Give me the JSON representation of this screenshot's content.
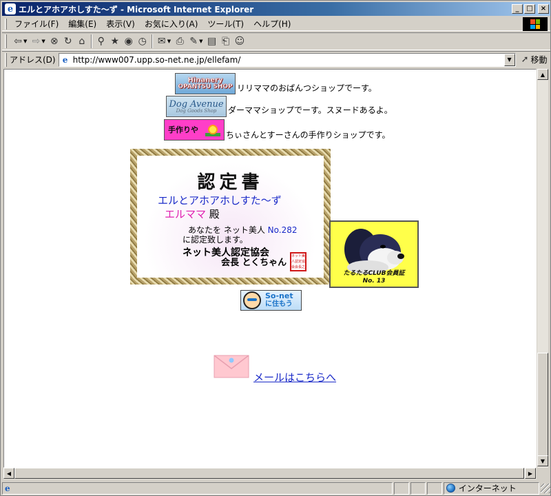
{
  "window": {
    "title": "エルとアホアホしすた〜ず - Microsoft Internet Explorer",
    "minimize": "_",
    "maximize": "□",
    "close": "×"
  },
  "menu": [
    {
      "label": "ファイル(F)"
    },
    {
      "label": "編集(E)"
    },
    {
      "label": "表示(V)"
    },
    {
      "label": "お気に入り(A)"
    },
    {
      "label": "ツール(T)"
    },
    {
      "label": "ヘルプ(H)"
    }
  ],
  "toolbar": {
    "icons": [
      "back-icon",
      "forward-icon",
      "stop-icon",
      "refresh-icon",
      "home-icon",
      "search-icon",
      "favorites-icon",
      "history-icon",
      "media-icon",
      "edit-icon",
      "print-icon",
      "mail-icon",
      "document-icon",
      "print-preview-icon",
      "messenger-icon"
    ]
  },
  "address": {
    "label": "アドレス(D)",
    "url": "http://www007.upp.so-net.ne.jp/ellefam/",
    "go_label": "移動"
  },
  "page": {
    "shops": [
      {
        "banner_line1": "Hinanery",
        "banner_line2": "OPANTSU SHOP",
        "text": "リリママのおぱんつショップでーす。"
      },
      {
        "banner_line1": "Dog Avenue",
        "banner_line2": "Dog Goods Shop",
        "text": "ダーママショップでーす。スヌードあるよ。"
      },
      {
        "banner_line1": "手作りや",
        "banner_line2": "",
        "text": "ちぃさんとすーさんの手作りショップです。"
      }
    ],
    "certificate": {
      "title": "認定書",
      "site_name": "エルとアホアホしすた〜ず",
      "person_name": "エルママ",
      "honorific": "殿",
      "text_prefix": "あなたを ネット美人",
      "number": "No.282",
      "text_line2": "に認定致します。",
      "association": "ネット美人認定協会",
      "chief": "会長 とくちゃん",
      "seal": "ネット美人認定協会会長之印"
    },
    "club_badge": {
      "line1": "たるたるCLUB会員証",
      "line2": "No. 13"
    },
    "sonet_banner": {
      "line1": "So-net",
      "line2": "に住もう"
    },
    "mail": {
      "link_text": "メール",
      "rest_text": "はこちらへ"
    }
  },
  "status": {
    "text": "",
    "zone": "インターネット"
  },
  "colors": {
    "titlebar": "#0a246a",
    "link": "#1a2ac8",
    "magenta": "#e020b0",
    "badge_yellow": "#ffff4a"
  }
}
